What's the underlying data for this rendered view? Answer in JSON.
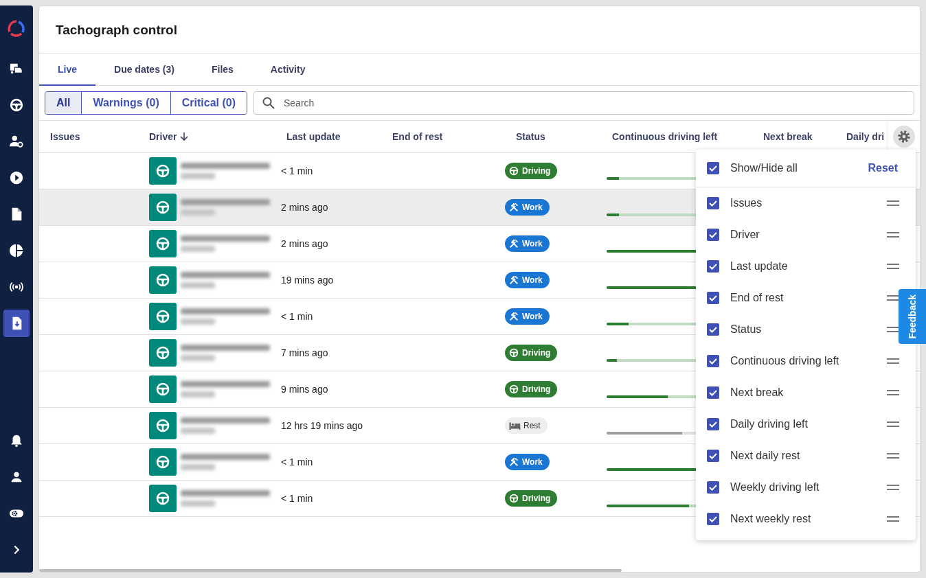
{
  "sidebar": {
    "top_items": [
      {
        "kind": "vehicles",
        "selected": false
      },
      {
        "kind": "wheel",
        "selected": false
      },
      {
        "kind": "driver",
        "selected": false
      },
      {
        "kind": "play",
        "selected": false
      },
      {
        "kind": "document",
        "selected": false
      },
      {
        "kind": "chart",
        "selected": false
      },
      {
        "kind": "signal",
        "selected": false
      },
      {
        "kind": "download",
        "selected": true
      }
    ],
    "bottom_items": [
      {
        "kind": "bell",
        "selected": false
      },
      {
        "kind": "person",
        "selected": false
      },
      {
        "kind": "settings",
        "selected": false
      },
      {
        "kind": "expand",
        "selected": false
      }
    ]
  },
  "title": "Tachograph control",
  "tabs": [
    {
      "label": "Live",
      "selected": true
    },
    {
      "label": "Due dates (3)",
      "selected": false
    },
    {
      "label": "Files",
      "selected": false
    },
    {
      "label": "Activity",
      "selected": false
    }
  ],
  "filters": [
    {
      "label": "All",
      "selected": true
    },
    {
      "label": "Warnings (0)",
      "selected": false
    },
    {
      "label": "Critical (0)",
      "selected": false
    }
  ],
  "search": {
    "placeholder": "Search"
  },
  "table": {
    "columns": [
      {
        "label": "Issues",
        "sorted": false
      },
      {
        "label": "Driver",
        "sorted": true
      },
      {
        "label": "Last update",
        "sorted": false
      },
      {
        "label": "End of rest",
        "sorted": false
      },
      {
        "label": "Status",
        "sorted": false
      },
      {
        "label": "Continuous driving left",
        "sorted": false
      },
      {
        "label": "Next break",
        "sorted": false
      },
      {
        "label": "Daily dri",
        "sorted": false
      }
    ],
    "rows": [
      {
        "last_update": "< 1 min",
        "status": {
          "kind": "driving",
          "label": "Driving"
        },
        "bar": {
          "kind": "active",
          "level": 0.12
        },
        "highlighted": false
      },
      {
        "last_update": "2 mins ago",
        "status": {
          "kind": "work",
          "label": "Work"
        },
        "bar": {
          "kind": "active",
          "level": 0.12
        },
        "highlighted": true
      },
      {
        "last_update": "2 mins ago",
        "status": {
          "kind": "work",
          "label": "Work"
        },
        "bar": {
          "kind": "active",
          "level": 0.95
        },
        "highlighted": false
      },
      {
        "last_update": "19 mins ago",
        "status": {
          "kind": "work",
          "label": "Work"
        },
        "bar": {
          "kind": "active",
          "level": 0.95
        },
        "highlighted": false
      },
      {
        "last_update": "< 1 min",
        "status": {
          "kind": "work",
          "label": "Work"
        },
        "bar": {
          "kind": "active",
          "level": 0.21
        },
        "highlighted": false
      },
      {
        "last_update": "7 mins ago",
        "status": {
          "kind": "driving",
          "label": "Driving"
        },
        "bar": {
          "kind": "active",
          "level": 0.1
        },
        "highlighted": false
      },
      {
        "last_update": "9 mins ago",
        "status": {
          "kind": "driving",
          "label": "Driving"
        },
        "bar": {
          "kind": "active",
          "level": 0.59
        },
        "highlighted": false
      },
      {
        "last_update": "12 hrs 19 mins ago",
        "status": {
          "kind": "rest",
          "label": "Rest"
        },
        "bar": {
          "kind": "idle",
          "level": 0.73
        },
        "highlighted": false
      },
      {
        "last_update": "< 1 min",
        "status": {
          "kind": "work",
          "label": "Work"
        },
        "bar": {
          "kind": "active",
          "level": 1.0
        },
        "highlighted": false
      },
      {
        "last_update": "< 1 min",
        "status": {
          "kind": "driving",
          "label": "Driving"
        },
        "bar": {
          "kind": "active",
          "level": 0.8
        },
        "highlighted": false
      }
    ]
  },
  "column_menu": {
    "show_all": {
      "label": "Show/Hide all",
      "checked": true
    },
    "reset": "Reset",
    "items": [
      {
        "label": "Issues",
        "checked": true
      },
      {
        "label": "Driver",
        "checked": true
      },
      {
        "label": "Last update",
        "checked": true
      },
      {
        "label": "End of rest",
        "checked": true
      },
      {
        "label": "Status",
        "checked": true
      },
      {
        "label": "Continuous driving left",
        "checked": true
      },
      {
        "label": "Next break",
        "checked": true
      },
      {
        "label": "Daily driving left",
        "checked": true
      },
      {
        "label": "Next daily rest",
        "checked": true
      },
      {
        "label": "Weekly driving left",
        "checked": true
      },
      {
        "label": "Next weekly rest",
        "checked": true
      }
    ]
  },
  "feedback": "Feedback"
}
